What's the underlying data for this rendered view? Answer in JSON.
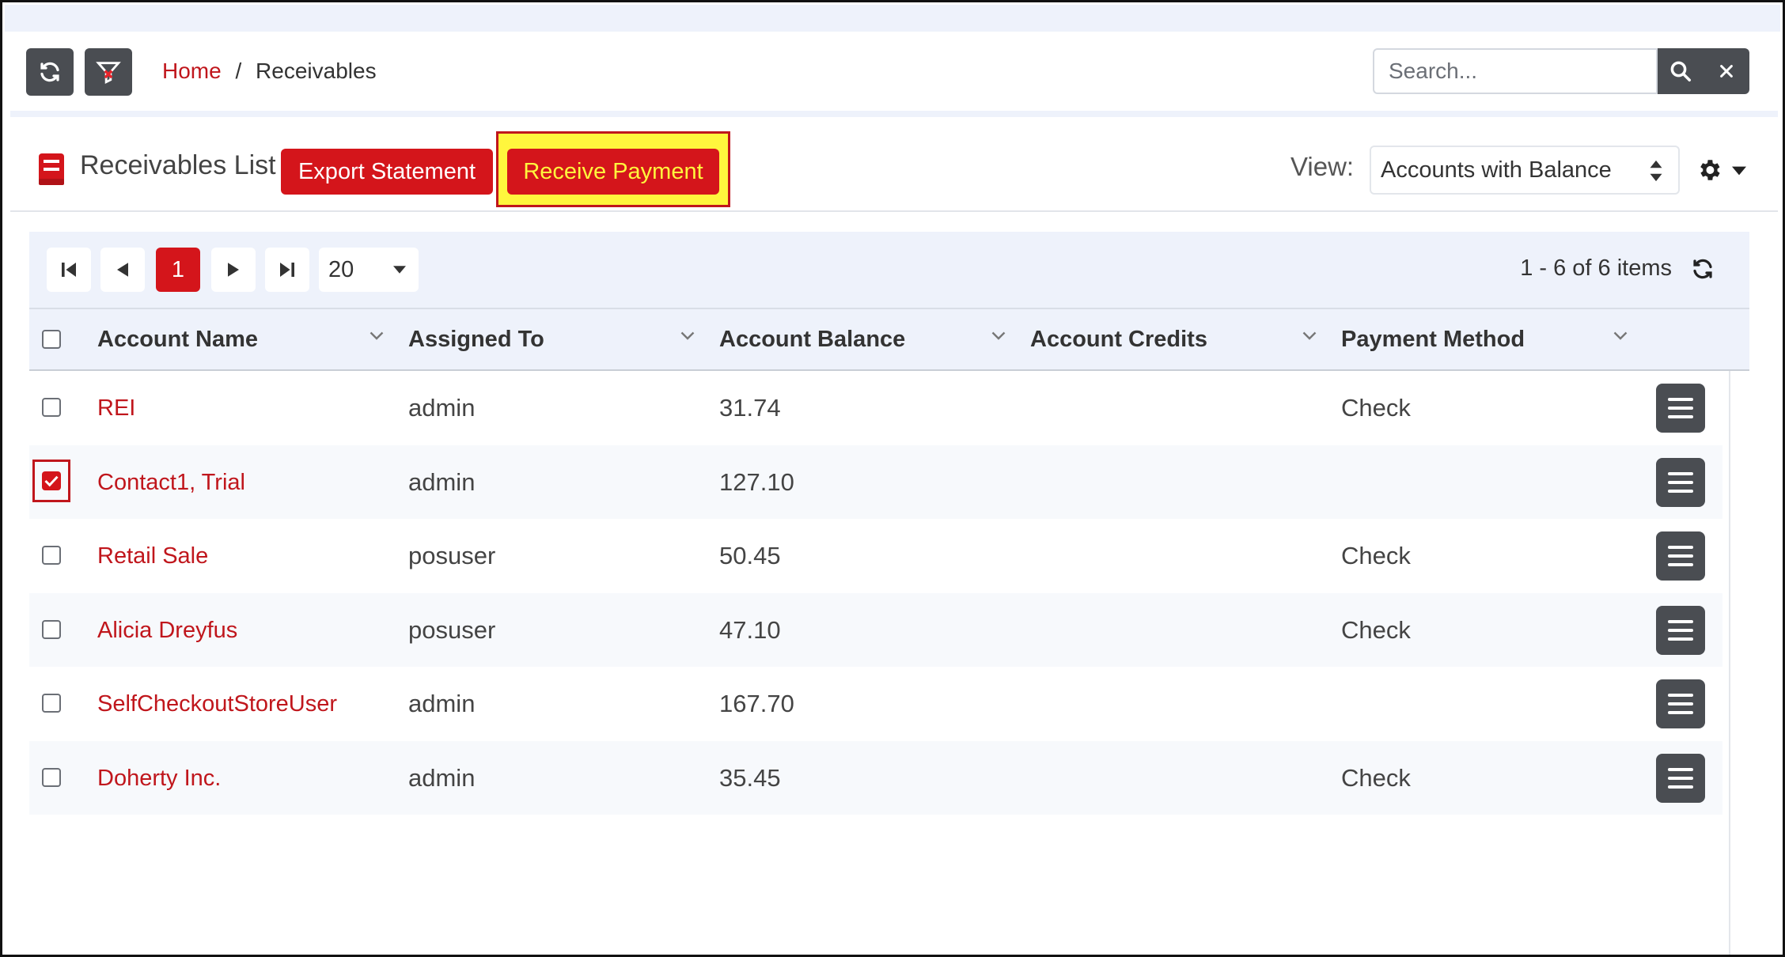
{
  "breadcrumb": {
    "home": "Home",
    "separator": "/",
    "current": "Receivables"
  },
  "search": {
    "placeholder": "Search..."
  },
  "toolbar": {
    "title": "Receivables List",
    "export_label": "Export Statement",
    "receive_label": "Receive Payment",
    "view_label": "View:",
    "view_value": "Accounts with Balance"
  },
  "pager": {
    "current_page": "1",
    "page_size": "20",
    "info": "1 - 6 of 6 items"
  },
  "columns": [
    "Account Name",
    "Assigned To",
    "Account Balance",
    "Account Credits",
    "Payment Method"
  ],
  "rows": [
    {
      "account": "REI",
      "assigned": "admin",
      "balance": "31.74",
      "credits": "",
      "method": "Check",
      "checked": false
    },
    {
      "account": "Contact1, Trial",
      "assigned": "admin",
      "balance": "127.10",
      "credits": "",
      "method": "",
      "checked": true
    },
    {
      "account": "Retail Sale",
      "assigned": "posuser",
      "balance": "50.45",
      "credits": "",
      "method": "Check",
      "checked": false
    },
    {
      "account": "Alicia Dreyfus",
      "assigned": "posuser",
      "balance": "47.10",
      "credits": "",
      "method": "Check",
      "checked": false
    },
    {
      "account": "SelfCheckoutStoreUser",
      "assigned": "admin",
      "balance": "167.70",
      "credits": "",
      "method": "",
      "checked": false
    },
    {
      "account": "Doherty Inc.",
      "assigned": "admin",
      "balance": "35.45",
      "credits": "",
      "method": "Check",
      "checked": false
    }
  ],
  "icons": {
    "refresh": "refresh-icon",
    "filter": "filter-clear-icon",
    "search": "search-icon",
    "clear": "close-icon",
    "book": "book-icon",
    "gear": "gear-icon",
    "menu": "hamburger-menu-icon"
  },
  "colors": {
    "accent": "#d4151b",
    "highlight": "#fff63d",
    "dark_button": "#4a4d52",
    "band": "#eef2fb"
  }
}
